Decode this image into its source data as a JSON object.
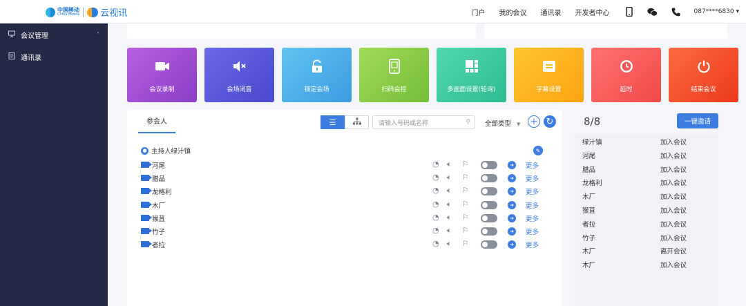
{
  "header": {
    "logo_cm_zh": "中国移动",
    "logo_cm_en": "China Mobile",
    "logo_product": "云视讯",
    "nav": [
      "门户",
      "我的会议",
      "通讯录",
      "开发者中心"
    ],
    "icons": [
      "mobile-icon",
      "wechat-icon",
      "phone-icon"
    ],
    "phone": "087****6830"
  },
  "sidebar": {
    "items": [
      {
        "label": "会议管理",
        "icon": "conference-icon",
        "expanded": true
      },
      {
        "label": "通讯录",
        "icon": "contacts-icon"
      }
    ]
  },
  "tiles": [
    {
      "label": "会议录制",
      "icon": "video-record-icon",
      "color": "#9b4fd4"
    },
    {
      "label": "会场闭音",
      "icon": "mute-all-icon",
      "color": "#5a58d8"
    },
    {
      "label": "锁定会场",
      "icon": "lock-icon",
      "color": "#4aaee8"
    },
    {
      "label": "扫码会控",
      "icon": "scan-phone-icon",
      "color": "#8acd45"
    },
    {
      "label": "多画面设置(轮询)",
      "icon": "multi-screen-icon",
      "color": "#3fcaa0"
    },
    {
      "label": "字幕设置",
      "icon": "subtitle-icon",
      "color": "#fdb21f"
    },
    {
      "label": "延时",
      "icon": "clock-icon",
      "color": "#f65c5c"
    },
    {
      "label": "结束会议",
      "icon": "power-icon",
      "color": "#f44a2a"
    }
  ],
  "participants_panel": {
    "tab": "参会人",
    "search_placeholder": "请输入号码或名称",
    "type_filter": "全部类型",
    "host_label": "主持人绿汁镇",
    "more_label": "更多",
    "participants": [
      "河尾",
      "腊品",
      "龙格利",
      "木厂",
      "猴苴",
      "竹子",
      "者拉"
    ]
  },
  "status_panel": {
    "count": "8/8",
    "invite_button": "一键邀请",
    "rows": [
      {
        "name": "绿汁镇",
        "status": "加入会议"
      },
      {
        "name": "河尾",
        "status": "加入会议"
      },
      {
        "name": "腊品",
        "status": "加入会议"
      },
      {
        "name": "龙格利",
        "status": "加入会议"
      },
      {
        "name": "木厂",
        "status": "加入会议"
      },
      {
        "name": "猴苴",
        "status": "加入会议"
      },
      {
        "name": "者拉",
        "status": "加入会议"
      },
      {
        "name": "竹子",
        "status": "加入会议"
      },
      {
        "name": "木厂",
        "status": "离开会议"
      },
      {
        "name": "木厂",
        "status": "加入会议"
      }
    ]
  }
}
